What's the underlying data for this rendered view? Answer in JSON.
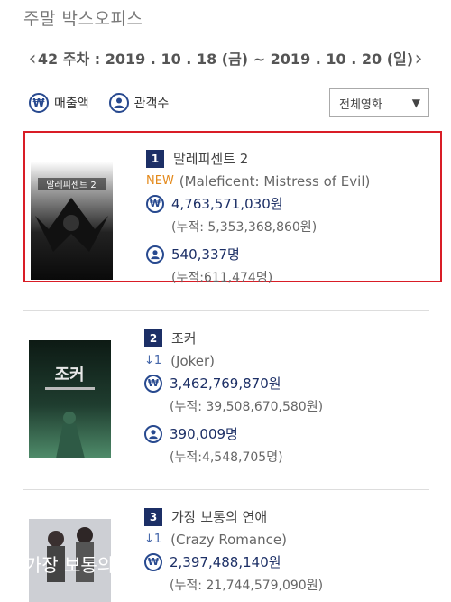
{
  "page": {
    "title": "주말 박스오피스"
  },
  "week": {
    "prev": "‹",
    "next": "›",
    "label": "42 주차 : 2019 . 10 . 18 (금) ~ 2019 . 10 . 20 (일)"
  },
  "toggles": {
    "sales_label": "매출액",
    "audience_label": "관객수",
    "won_symbol": "₩"
  },
  "filter": {
    "selected": "전체영화",
    "arrow": "▼"
  },
  "movies": [
    {
      "rank": "1",
      "title": "말레피센트 2",
      "badge": "NEW",
      "english": "(Maleficent: Mistress of Evil)",
      "sales": "4,763,571,030원",
      "sales_cum": "(누적: 5,353,368,860원)",
      "audience": "540,337명",
      "audience_cum": "(누적:611,474명)",
      "poster_text": "말레피센트 2"
    },
    {
      "rank": "2",
      "title": "조커",
      "badge": "↓1",
      "english": "(Joker)",
      "sales": "3,462,769,870원",
      "sales_cum": "(누적: 39,508,670,580원)",
      "audience": "390,009명",
      "audience_cum": "(누적:4,548,705명)",
      "poster_text": "조커"
    },
    {
      "rank": "3",
      "title": "가장 보통의 연애",
      "badge": "↓1",
      "english": "(Crazy Romance)",
      "sales": "2,397,488,140원",
      "sales_cum": "(누적: 21,744,579,090원)",
      "poster_text": "가장 보통의"
    }
  ]
}
